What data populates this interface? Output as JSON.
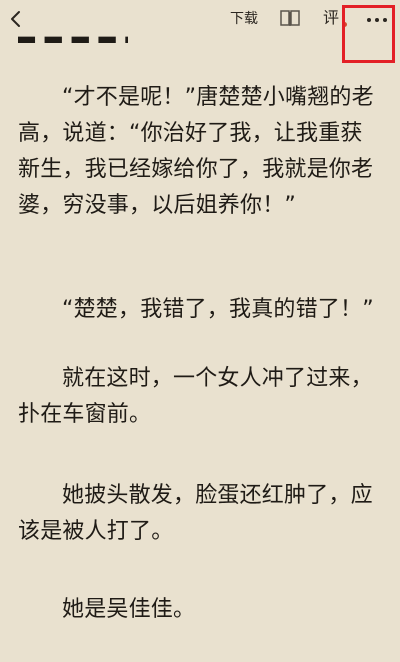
{
  "toolbar": {
    "back_icon": "chevron-left-icon",
    "download_label": "下载",
    "book_icon": "book-icon",
    "comment_label": "评",
    "more_icon": "more-horizontal-icon"
  },
  "content": {
    "paragraphs": [
      "“才不是呢！”唐楚楚小嘴翘的老高，说道：“你治好了我，让我重获新生，我已经嫁给你了，我就是你老婆，穷没事，以后姐养你！”",
      "“楚楚，我错了，我真的错了！”",
      "就在这时，一个女人冲了过来，扑在车窗前。",
      "她披头散发，脸蛋还红肿了，应该是被人打了。",
      "她是吴佳佳。"
    ]
  },
  "colors": {
    "page_background": "#e9e1cf",
    "text": "#1f1b16",
    "highlight_border": "#e32026",
    "comment_dot": "#d14b2f"
  }
}
